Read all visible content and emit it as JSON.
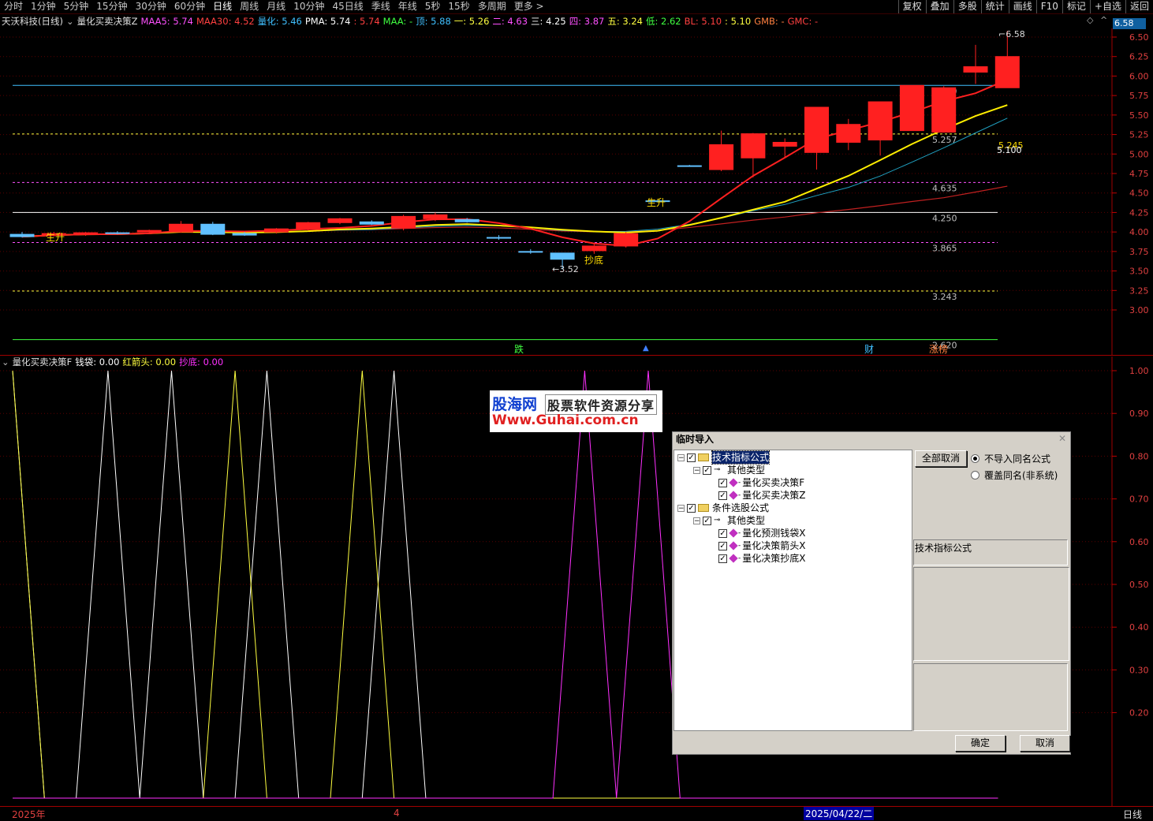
{
  "toolbar": {
    "periods": [
      "分时",
      "1分钟",
      "5分钟",
      "15分钟",
      "30分钟",
      "60分钟",
      "日线",
      "周线",
      "月线",
      "10分钟",
      "45日线",
      "季线",
      "年线",
      "5秒",
      "15秒",
      "多周期",
      "更多 >"
    ],
    "active_period": "日线",
    "right_buttons": [
      "复权",
      "叠加",
      "多股",
      "统计",
      "画线",
      "F10",
      "标记",
      "+自选",
      "返回"
    ]
  },
  "main_info": {
    "title": "天沃科技(日线)",
    "formula": "量化买卖决策Z",
    "items": [
      {
        "label": "MAA5:",
        "value": "5.74",
        "color": "#ff50ff"
      },
      {
        "label": "MAA30:",
        "value": "4.52",
        "color": "#ff4040"
      },
      {
        "label": "量化:",
        "value": "5.46",
        "color": "#40c0ff"
      },
      {
        "label": "PMA:",
        "value": "5.74",
        "color": "#ffffff"
      },
      {
        "label": ":",
        "value": "5.74",
        "color": "#ff4040"
      },
      {
        "label": "MAA:",
        "value": "-",
        "color": "#40ff40"
      },
      {
        "label": "顶:",
        "value": "5.88",
        "color": "#40c0ff"
      },
      {
        "label": "一:",
        "value": "5.26",
        "color": "#ffff40"
      },
      {
        "label": "二:",
        "value": "4.63",
        "color": "#ff50ff"
      },
      {
        "label": "三:",
        "value": "4.25",
        "color": "#ffffff"
      },
      {
        "label": "四:",
        "value": "3.87",
        "color": "#ff50ff"
      },
      {
        "label": "五:",
        "value": "3.24",
        "color": "#ffff40"
      },
      {
        "label": "低:",
        "value": "2.62",
        "color": "#40ff40"
      },
      {
        "label": "BL:",
        "value": "5.10",
        "color": "#ff4040"
      },
      {
        "label": ":",
        "value": "5.10",
        "color": "#ffff40"
      },
      {
        "label": "GMB:",
        "value": "-",
        "color": "#ff8040"
      },
      {
        "label": "GMC:",
        "value": "-",
        "color": "#ff4040"
      }
    ]
  },
  "price_axis": {
    "current_price_tag": "6.58",
    "ticks": [
      "6.50",
      "6.25",
      "6.00",
      "5.75",
      "5.50",
      "5.25",
      "5.00",
      "4.75",
      "4.50",
      "4.25",
      "4.00",
      "3.75",
      "3.50",
      "3.25",
      "3.00"
    ]
  },
  "levels": [
    {
      "label": "5.880",
      "price": 5.88,
      "color": "#40c0ff",
      "dash": false
    },
    {
      "label": "5.257",
      "price": 5.257,
      "color": "#ffff40",
      "dash": true
    },
    {
      "label": "4.635",
      "price": 4.635,
      "color": "#ff50ff",
      "dash": true
    },
    {
      "label": "4.250",
      "price": 4.25,
      "color": "#ffffff",
      "dash": false
    },
    {
      "label": "3.865",
      "price": 3.865,
      "color": "#ff50ff",
      "dash": true
    },
    {
      "label": "3.243",
      "price": 3.243,
      "color": "#ffff40",
      "dash": true
    },
    {
      "label": "2.620",
      "price": 2.62,
      "color": "#40ff40",
      "dash": false
    }
  ],
  "chart_labels": {
    "high_marker": "6.58",
    "low_marker": "3.52",
    "rise_label_1": "生升",
    "rise_label_2": "生升",
    "bottom_label": "抄底",
    "line_label_a": "5.245",
    "line_label_b": "5.100",
    "event_fall": "跌",
    "event_fin": "财",
    "event_limit": "涨榜"
  },
  "chart_data": [
    {
      "type": "candlestick",
      "title": "天沃科技(日线)",
      "ylim": [
        2.8,
        6.7
      ],
      "candles": [
        {
          "o": 3.97,
          "h": 4.0,
          "l": 3.93,
          "c": 3.94,
          "up": false
        },
        {
          "o": 3.96,
          "h": 4.0,
          "l": 3.94,
          "c": 3.98,
          "up": true
        },
        {
          "o": 3.97,
          "h": 4.0,
          "l": 3.95,
          "c": 3.99,
          "up": true
        },
        {
          "o": 3.99,
          "h": 4.01,
          "l": 3.97,
          "c": 3.98,
          "up": false
        },
        {
          "o": 4.0,
          "h": 4.03,
          "l": 3.98,
          "c": 4.02,
          "up": true
        },
        {
          "o": 4.0,
          "h": 4.14,
          "l": 3.99,
          "c": 4.1,
          "up": true
        },
        {
          "o": 4.1,
          "h": 4.13,
          "l": 3.96,
          "c": 3.97,
          "up": false
        },
        {
          "o": 3.98,
          "h": 4.0,
          "l": 3.95,
          "c": 3.96,
          "up": false
        },
        {
          "o": 4.0,
          "h": 4.05,
          "l": 3.98,
          "c": 4.04,
          "up": true
        },
        {
          "o": 4.03,
          "h": 4.13,
          "l": 4.02,
          "c": 4.12,
          "up": true
        },
        {
          "o": 4.12,
          "h": 4.18,
          "l": 4.1,
          "c": 4.17,
          "up": true
        },
        {
          "o": 4.13,
          "h": 4.15,
          "l": 4.09,
          "c": 4.1,
          "up": false
        },
        {
          "o": 4.05,
          "h": 4.22,
          "l": 4.02,
          "c": 4.2,
          "up": true
        },
        {
          "o": 4.17,
          "h": 4.25,
          "l": 4.14,
          "c": 4.22,
          "up": true
        },
        {
          "o": 4.16,
          "h": 4.18,
          "l": 4.12,
          "c": 4.13,
          "up": false
        },
        {
          "o": 3.93,
          "h": 3.96,
          "l": 3.9,
          "c": 3.92,
          "up": false
        },
        {
          "o": 3.75,
          "h": 3.78,
          "l": 3.72,
          "c": 3.74,
          "up": false
        },
        {
          "o": 3.73,
          "h": 3.73,
          "l": 3.52,
          "c": 3.65,
          "up": false
        },
        {
          "o": 3.76,
          "h": 3.86,
          "l": 3.72,
          "c": 3.82,
          "up": true
        },
        {
          "o": 3.82,
          "h": 4.0,
          "l": 3.8,
          "c": 3.98,
          "up": true
        },
        {
          "o": 4.4,
          "h": 4.41,
          "l": 4.38,
          "c": 4.39,
          "up": false
        },
        {
          "o": 4.85,
          "h": 4.86,
          "l": 4.84,
          "c": 4.85,
          "up": false
        },
        {
          "o": 4.8,
          "h": 5.3,
          "l": 4.78,
          "c": 5.12,
          "up": true
        },
        {
          "o": 4.95,
          "h": 5.27,
          "l": 4.7,
          "c": 5.26,
          "up": true
        },
        {
          "o": 5.1,
          "h": 5.2,
          "l": 4.95,
          "c": 5.15,
          "up": true
        },
        {
          "o": 5.02,
          "h": 5.6,
          "l": 4.8,
          "c": 5.6,
          "up": true
        },
        {
          "o": 5.15,
          "h": 5.45,
          "l": 5.05,
          "c": 5.38,
          "up": true
        },
        {
          "o": 5.18,
          "h": 5.67,
          "l": 4.98,
          "c": 5.67,
          "up": true
        },
        {
          "o": 5.3,
          "h": 5.88,
          "l": 5.3,
          "c": 5.88,
          "up": true
        },
        {
          "o": 5.28,
          "h": 5.87,
          "l": 5.28,
          "c": 5.85,
          "up": true
        },
        {
          "o": 6.05,
          "h": 6.4,
          "l": 5.9,
          "c": 6.12,
          "up": true
        },
        {
          "o": 5.85,
          "h": 6.58,
          "l": 5.85,
          "c": 6.25,
          "up": true
        }
      ]
    },
    {
      "type": "line",
      "title": "量化买卖决策F",
      "ylim": [
        0,
        1
      ],
      "series": [
        {
          "name": "钱袋",
          "value_label": "0.00",
          "color": "#ffffff",
          "values": [
            1,
            0,
            0,
            1,
            0,
            1,
            0,
            0,
            1,
            0,
            0,
            0,
            1,
            0,
            0,
            0,
            0,
            0,
            0,
            0,
            0,
            0,
            0,
            0,
            0,
            0,
            0,
            0,
            0,
            0,
            0,
            0
          ]
        },
        {
          "name": "红箭头",
          "value_label": "0.00",
          "color": "#ffff40",
          "values": [
            1,
            0,
            0,
            0,
            0,
            0,
            0,
            1,
            0,
            0,
            0,
            1,
            0,
            0,
            0,
            0,
            0,
            0,
            0,
            0,
            0,
            0,
            0,
            0,
            0,
            0,
            0,
            0,
            0,
            0,
            0,
            0
          ]
        },
        {
          "name": "抄底",
          "value_label": "0.00",
          "color": "#ff30ff",
          "values": [
            0,
            0,
            0,
            0,
            0,
            0,
            0,
            0,
            0,
            0,
            0,
            0,
            0,
            0,
            0,
            0,
            0,
            0,
            1,
            0,
            1,
            0,
            0,
            0,
            0,
            0,
            0,
            0,
            0,
            0,
            0,
            0
          ]
        }
      ],
      "yticks": [
        "1.00",
        "0.90",
        "0.80",
        "0.70",
        "0.60",
        "0.50",
        "0.40",
        "0.30",
        "0.20"
      ]
    }
  ],
  "sub_info": {
    "formula": "量化买卖决策F"
  },
  "bottom_axis": {
    "year_label": "2025年",
    "month_label": "4",
    "date_cursor": "2025/04/22/二",
    "period_label": "日线"
  },
  "watermark": {
    "site_name": "股海网",
    "slogan": "股票软件资源分享",
    "url": "Www.Guhai.com.cn"
  },
  "dialog": {
    "title": "临时导入",
    "tree": [
      {
        "label": "技术指标公式",
        "level": 0,
        "kind": "folder",
        "selected": true
      },
      {
        "label": "其他类型",
        "level": 1,
        "kind": "key"
      },
      {
        "label": "量化买卖决策F",
        "level": 2,
        "kind": "item"
      },
      {
        "label": "量化买卖决策Z",
        "level": 2,
        "kind": "item"
      },
      {
        "label": "条件选股公式",
        "level": 0,
        "kind": "folder"
      },
      {
        "label": "其他类型",
        "level": 1,
        "kind": "key"
      },
      {
        "label": "量化预测钱袋X",
        "level": 2,
        "kind": "item"
      },
      {
        "label": "量化决策箭头X",
        "level": 2,
        "kind": "item"
      },
      {
        "label": "量化决策抄底X",
        "level": 2,
        "kind": "item"
      }
    ],
    "deselect_all_label": "全部取消",
    "radio_no_import": "不导入同名公式",
    "radio_overwrite": "覆盖同名(非系统)",
    "type_text": "技术指标公式",
    "ok_label": "确定",
    "cancel_label": "取消"
  }
}
